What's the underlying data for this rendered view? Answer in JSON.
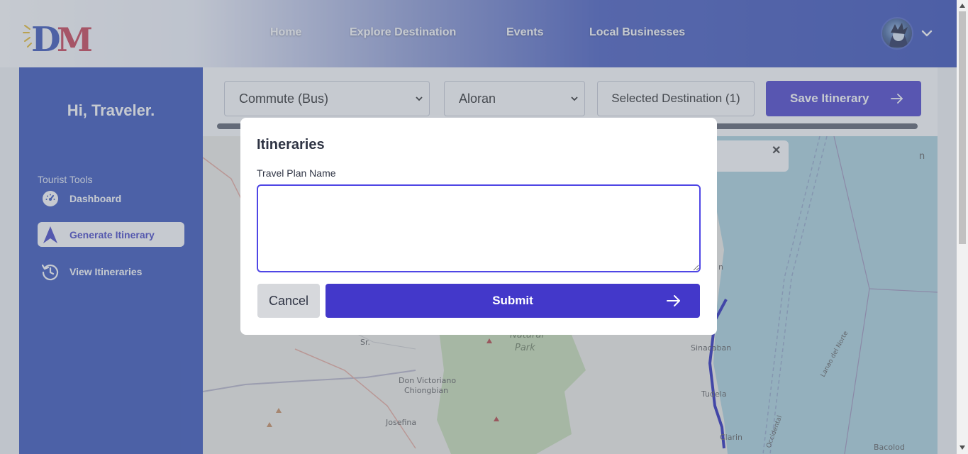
{
  "header": {
    "logo_text": "DM",
    "nav": [
      "Home",
      "Explore Destination",
      "Events",
      "Local Businesses"
    ]
  },
  "sidebar": {
    "greeting": "Hi, Traveler.",
    "section_label": "Tourist Tools",
    "items": [
      {
        "label": "Dashboard",
        "icon": "speedometer-icon",
        "active": false
      },
      {
        "label": "Generate Itinerary",
        "icon": "navigation-arrow-icon",
        "active": true
      },
      {
        "label": "View Itineraries",
        "icon": "history-icon",
        "active": false
      }
    ]
  },
  "toolbar": {
    "transport_select": "Commute (Bus)",
    "location_select": "Aloran",
    "selected_destination": "Selected Destination (1)",
    "save_label": "Save Itinerary"
  },
  "map": {
    "labels": [
      "Natural",
      "Park",
      "Sr.",
      "Don Victoriano",
      "Chiongbian",
      "Josefina",
      "Sinacaban",
      "Tudela",
      "Clarin",
      "Bacolod",
      "Lanao del Norte",
      "Occidental",
      "n",
      "n"
    ]
  },
  "modal": {
    "title": "Itineraries",
    "field_label": "Travel Plan Name",
    "field_value": "",
    "cancel_label": "Cancel",
    "submit_label": "Submit"
  },
  "colors": {
    "primary": "#4338ca",
    "sidebar": "#2d4bb8",
    "header_end": "#2f47b6"
  }
}
